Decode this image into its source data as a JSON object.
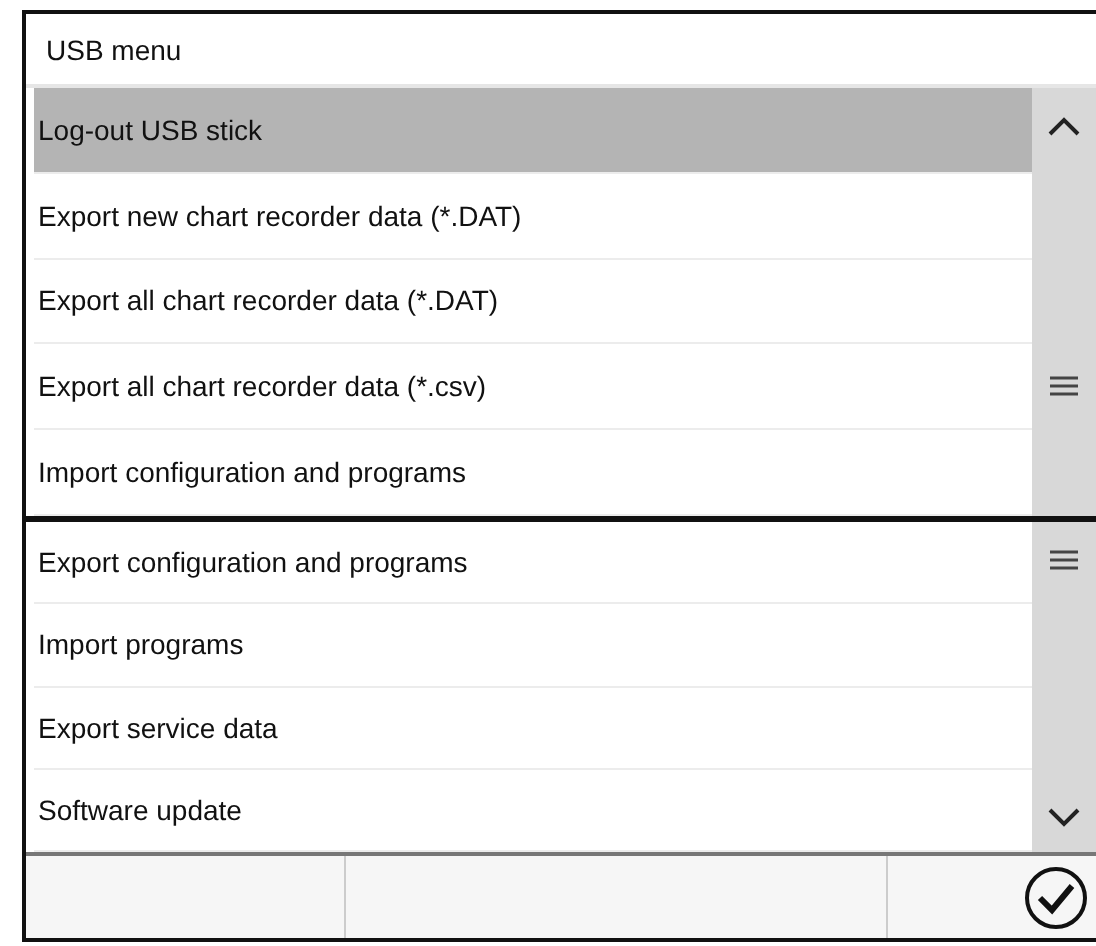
{
  "window": {
    "title": "USB menu"
  },
  "sections": [
    {
      "items": [
        {
          "label": "Log-out USB stick",
          "selected": true
        },
        {
          "label": "Export new chart recorder data (*.DAT)",
          "selected": false
        },
        {
          "label": "Export all chart recorder data (*.DAT)",
          "selected": false
        },
        {
          "label": "Export all chart recorder data (*.csv)",
          "selected": false
        },
        {
          "label": "Import configuration and programs",
          "selected": false
        }
      ]
    },
    {
      "items": [
        {
          "label": "Export configuration and programs",
          "selected": false
        },
        {
          "label": "Import programs",
          "selected": false
        },
        {
          "label": "Export service data",
          "selected": false
        },
        {
          "label": "Software update",
          "selected": false
        }
      ]
    }
  ]
}
